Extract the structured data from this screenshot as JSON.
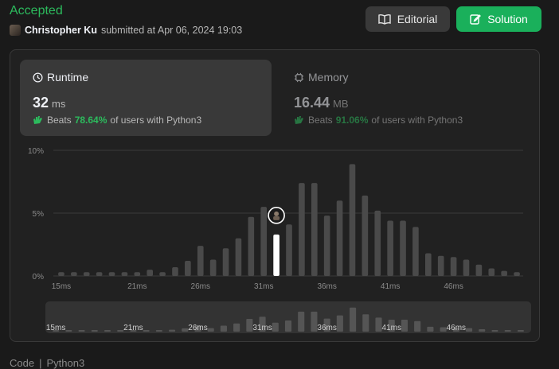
{
  "header": {
    "status": "Accepted",
    "author": "Christopher Ku",
    "submitted_text": "submitted at Apr 06, 2024 19:03",
    "editorial_label": "Editorial",
    "solution_label": "Solution",
    "accent_green": "#2cbb5d"
  },
  "runtime": {
    "title": "Runtime",
    "value": "32",
    "unit": "ms",
    "beats_prefix": "Beats",
    "beats_pct": "78.64%",
    "beats_suffix": "of users with Python3"
  },
  "memory": {
    "title": "Memory",
    "value": "16.44",
    "unit": "MB",
    "beats_prefix": "Beats",
    "beats_pct": "91.06%",
    "beats_suffix": "of users with Python3"
  },
  "footer": {
    "code_tab": "Code",
    "separator": "|",
    "language": "Python3"
  },
  "chart_data": {
    "type": "bar",
    "y_ticks": [
      "10%",
      "5%",
      "0%"
    ],
    "ylim": [
      0,
      10
    ],
    "x_tick_labels": [
      "15ms",
      "21ms",
      "26ms",
      "31ms",
      "36ms",
      "41ms",
      "46ms"
    ],
    "x_tick_positions": [
      15,
      21,
      26,
      31,
      36,
      41,
      46
    ],
    "x": [
      15,
      16,
      17,
      18,
      19,
      20,
      21,
      22,
      23,
      24,
      25,
      26,
      27,
      28,
      29,
      30,
      31,
      32,
      33,
      34,
      35,
      36,
      37,
      38,
      39,
      40,
      41,
      42,
      43,
      44,
      45,
      46,
      47,
      48,
      49
    ],
    "values": [
      0.3,
      0.3,
      0.3,
      0.3,
      0.3,
      0.3,
      0.3,
      0.5,
      0.3,
      0.7,
      1.2,
      2.4,
      1.3,
      2.2,
      3.0,
      4.7,
      5.5,
      3.3,
      4.1,
      7.4,
      7.4,
      4.8,
      6.0,
      8.9,
      6.4,
      5.2,
      4.4,
      4.4,
      3.9,
      1.8,
      1.6,
      1.5,
      1.3,
      0.9,
      0.6,
      0.4,
      0.3
    ],
    "highlight_x": 32,
    "highlight_label": "your submission (32 ms)",
    "grid": true
  }
}
